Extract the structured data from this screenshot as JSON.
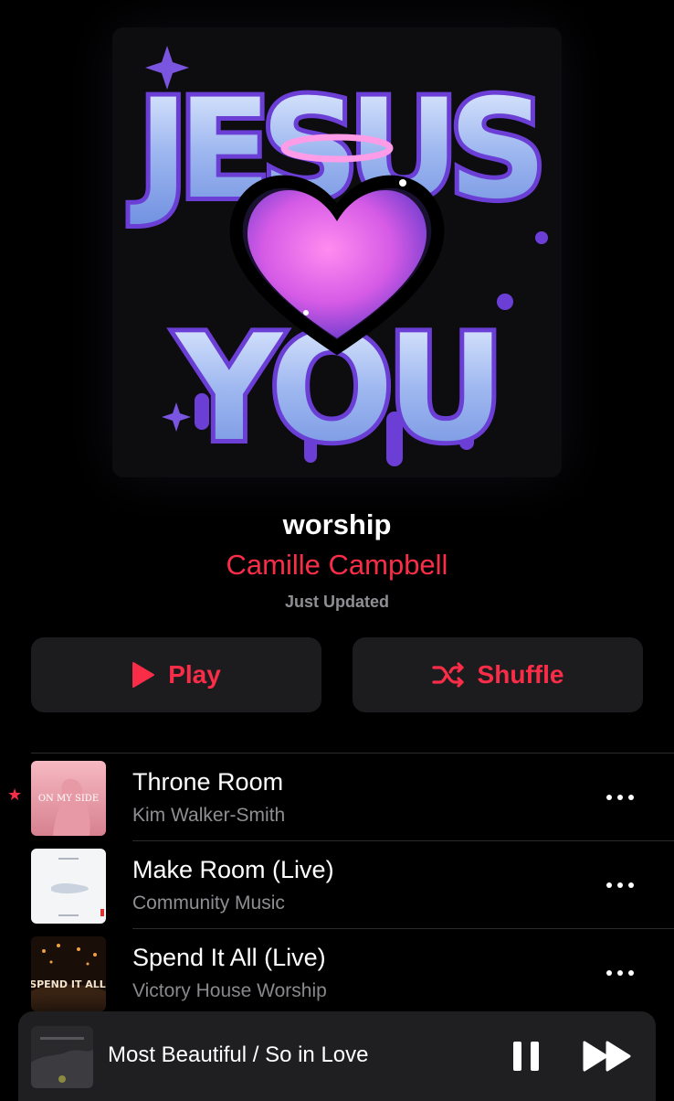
{
  "playlist": {
    "title": "worship",
    "owner": "Camille Campbell",
    "updated": "Just Updated",
    "artwork_text": [
      "JESUS",
      "YOU"
    ],
    "artwork_icon": "heart-with-halo"
  },
  "actions": {
    "play_label": "Play",
    "play_icon": "play-icon",
    "shuffle_label": "Shuffle",
    "shuffle_icon": "shuffle-icon"
  },
  "tracks": [
    {
      "title": "Throne Room",
      "artist": "Kim Walker-Smith",
      "art_text": "ON MY SIDE",
      "favorite": true
    },
    {
      "title": "Make Room (Live)",
      "artist": "Community Music",
      "favorite": false
    },
    {
      "title": "Spend It All (Live)",
      "artist": "Victory House Worship",
      "art_text": "SPEND IT ALL",
      "favorite": false
    }
  ],
  "now_playing": {
    "title": "Most Beautiful / So in Love",
    "controls": [
      "pause-icon",
      "forward-icon"
    ]
  },
  "colors": {
    "accent": "#fa2d48",
    "background": "#000000",
    "button_bg": "#1c1c1e",
    "secondary_text": "#8e8e93"
  }
}
